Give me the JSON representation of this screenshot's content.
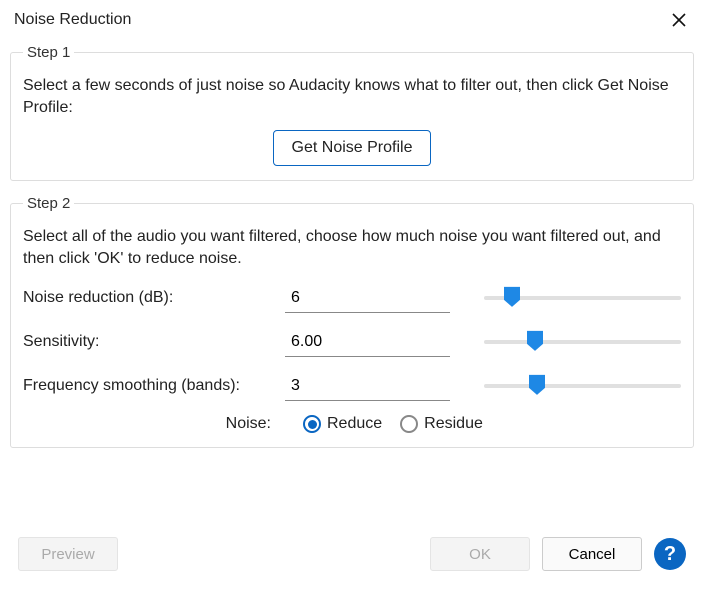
{
  "title": "Noise Reduction",
  "step1": {
    "legend": "Step 1",
    "instructions": "Select a few seconds of just noise so Audacity knows what to filter out, then click Get Noise Profile:",
    "button": "Get Noise Profile"
  },
  "step2": {
    "legend": "Step 2",
    "instructions": "Select all of the audio you want filtered, choose how much noise you want filtered out, and then click 'OK' to reduce noise.",
    "params": {
      "noise_reduction": {
        "label": "Noise reduction (dB):",
        "value": "6",
        "slider_pct": 14
      },
      "sensitivity": {
        "label": "Sensitivity:",
        "value": "6.00",
        "slider_pct": 26
      },
      "frequency": {
        "label": "Frequency smoothing (bands):",
        "value": "3",
        "slider_pct": 27
      }
    },
    "radio": {
      "lead": "Noise:",
      "options": {
        "reduce": "Reduce",
        "residue": "Residue"
      },
      "selected": "reduce"
    }
  },
  "footer": {
    "preview": "Preview",
    "ok": "OK",
    "cancel": "Cancel",
    "help": "?"
  }
}
